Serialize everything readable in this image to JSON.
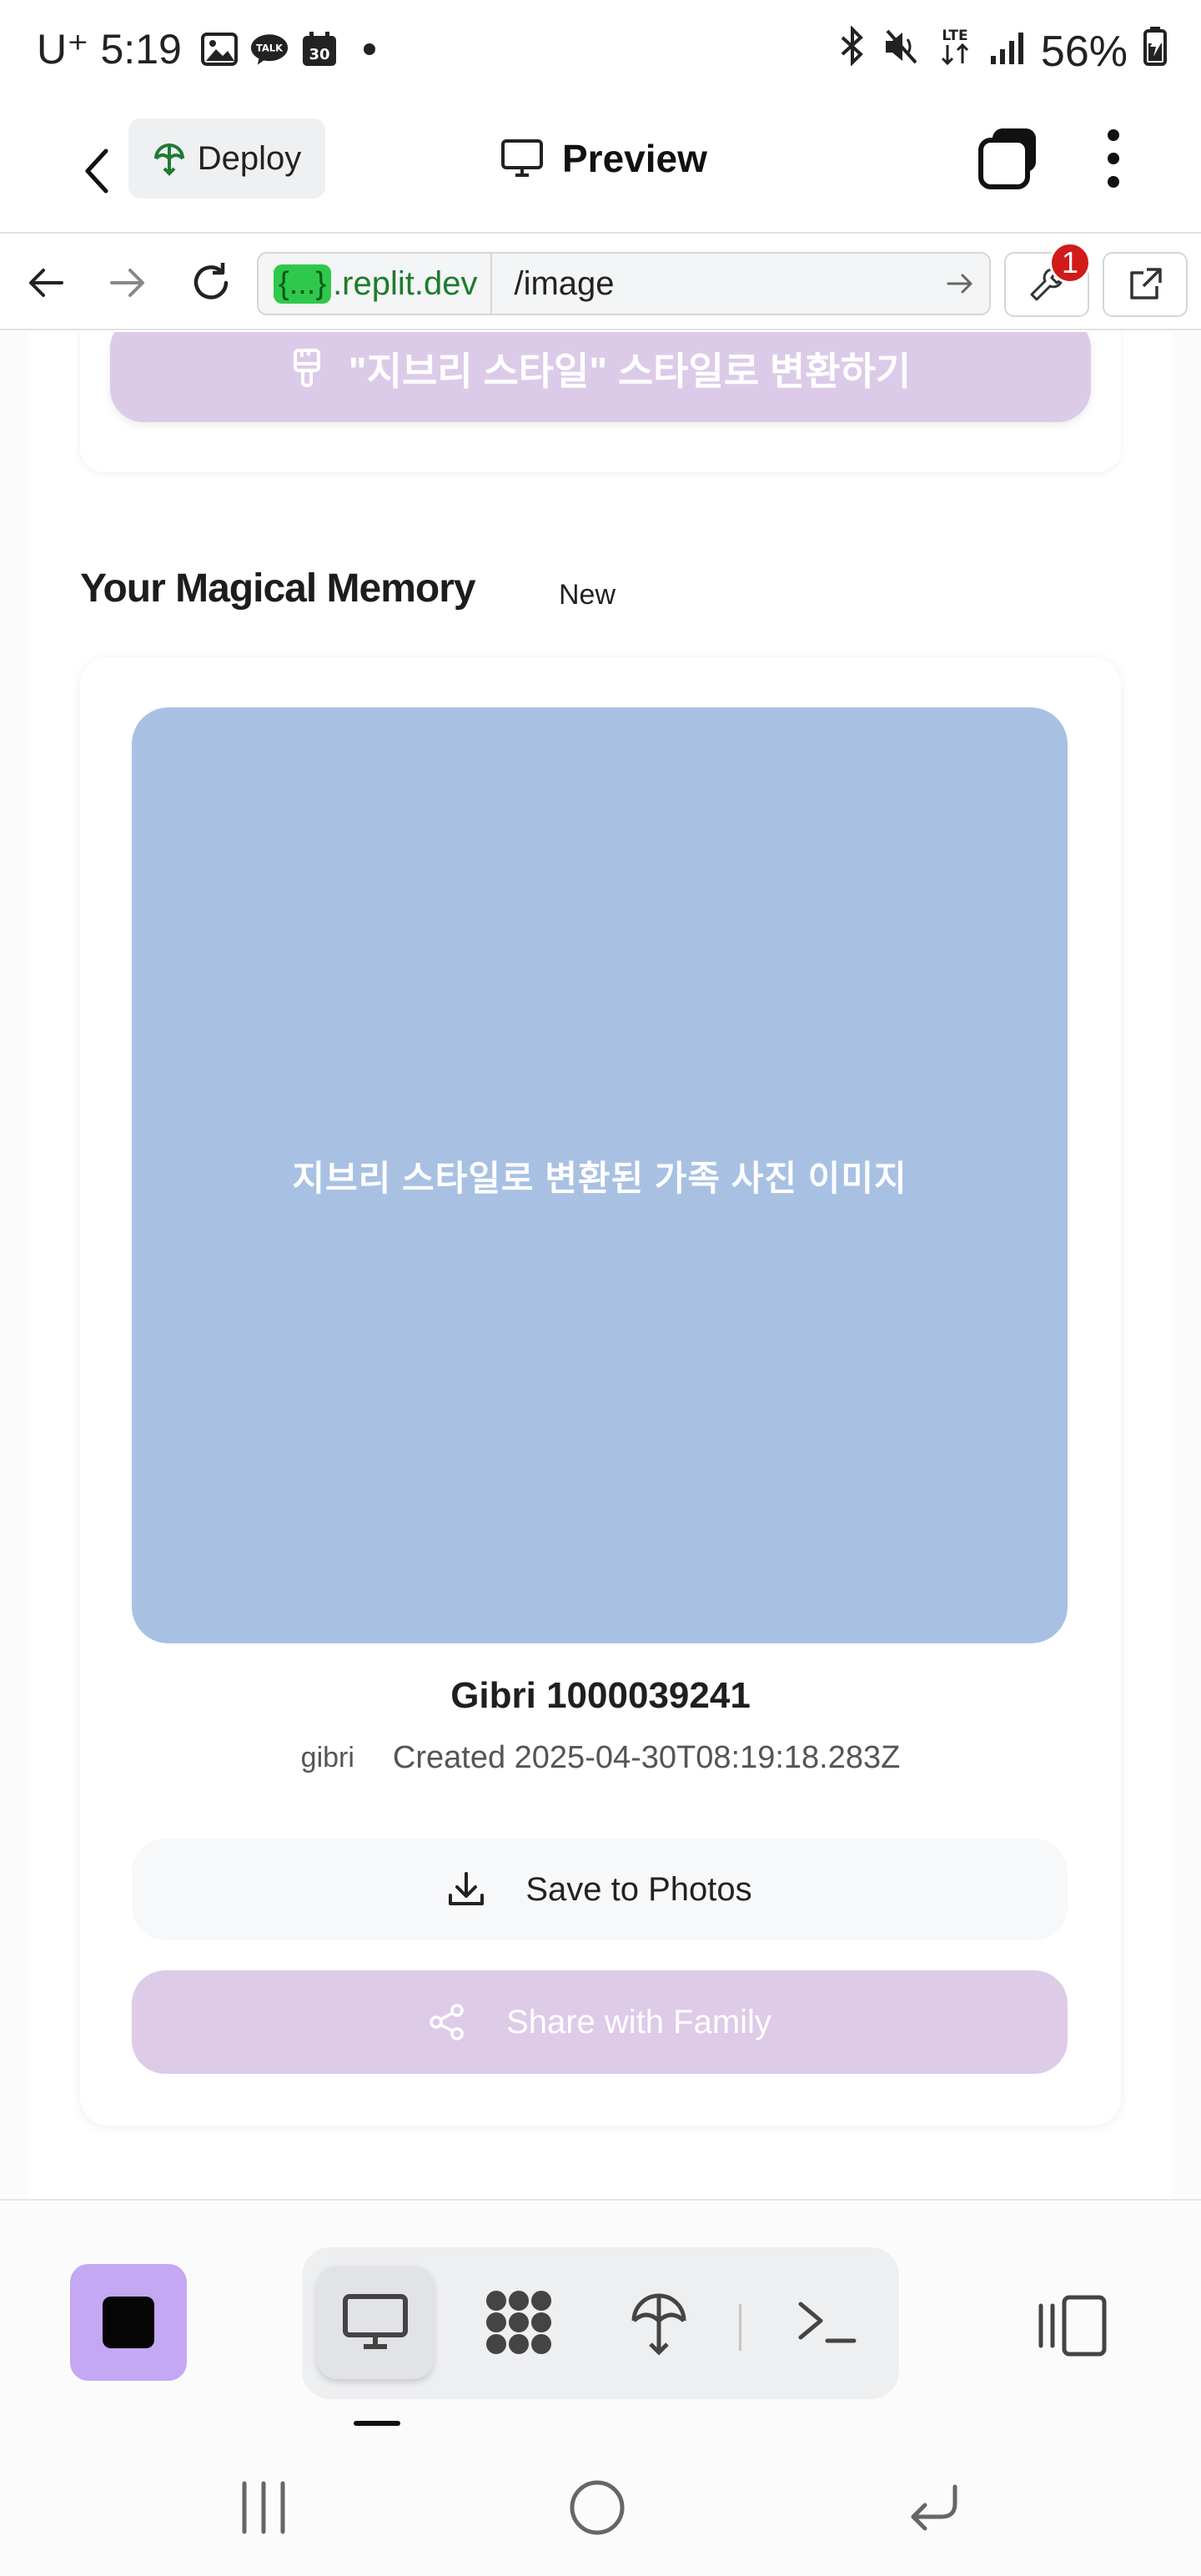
{
  "status_bar": {
    "carrier": "U⁺",
    "time": "5:19",
    "notification_icons": [
      "gallery-icon",
      "kakaotalk-icon",
      "calendar-icon",
      "dot-icon"
    ],
    "calendar_day": "30",
    "talk_label": "TALK",
    "network": "LTE",
    "battery": "56%"
  },
  "header": {
    "deploy_label": "Deploy",
    "preview_label": "Preview"
  },
  "url_bar": {
    "badge_text": "{...}",
    "host": ".replit.dev",
    "path": "/image",
    "devtools_badge": "1"
  },
  "page": {
    "convert_button": "\"지브리 스타일\" 스타일로 변환하기",
    "section_title": "Your Magical Memory",
    "section_badge": "New",
    "image_alt": "지브리 스타일로 변환된 가족 사진 이미지",
    "memory_title": "Gibri 1000039241",
    "tag": "gibri",
    "created": "Created 2025-04-30T08:19:18.283Z",
    "save_button": "Save to Photos",
    "share_button": "Share with Family"
  },
  "colors": {
    "image_bg": "#a8c1e3",
    "convert_bg": "#dccbe8",
    "share_bg": "#ddcbe8",
    "stop_bg": "#c4a8f4",
    "url_host": "#1e7b2c",
    "badge_red": "#d11a1a"
  }
}
